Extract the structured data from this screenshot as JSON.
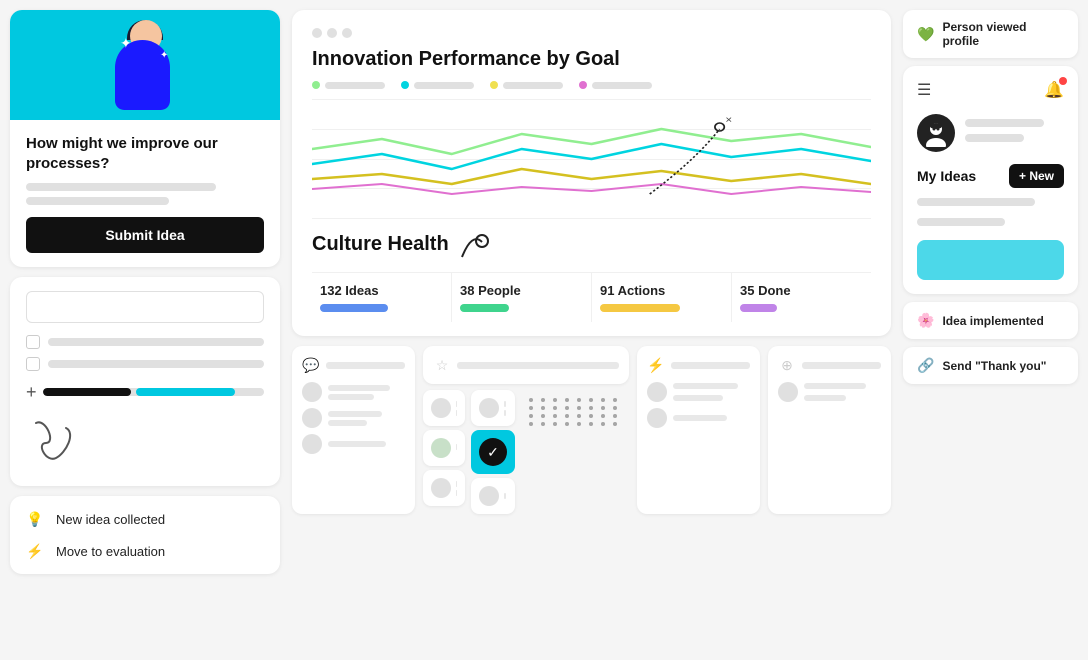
{
  "left": {
    "card_idea": {
      "title": "How might we improve our processes?",
      "submit_label": "Submit Idea"
    },
    "notifications": {
      "new_idea": "New idea collected",
      "move_eval": "Move to evaluation"
    }
  },
  "center": {
    "chart": {
      "window_dots": [
        "red",
        "yellow",
        "green"
      ],
      "title": "Innovation Performance by Goal",
      "legend": [
        {
          "color": "#90ee90",
          "label": ""
        },
        {
          "color": "#00d4e0",
          "label": ""
        },
        {
          "color": "#f0e050",
          "label": ""
        },
        {
          "color": "#e070d0",
          "label": ""
        }
      ],
      "culture_health": "Culture Health",
      "stats": [
        {
          "label": "132 Ideas",
          "bar_color": "#5b8def",
          "width": "55%"
        },
        {
          "label": "38 People",
          "bar_color": "#3fd48d",
          "width": "40%"
        },
        {
          "label": "91 Actions",
          "bar_color": "#f5c842",
          "width": "65%"
        },
        {
          "label": "35 Done",
          "bar_color": "#c084e8",
          "width": "30%"
        }
      ]
    }
  },
  "right": {
    "person_viewed": "Person viewed profile",
    "my_ideas": "My Ideas",
    "new_btn": "+ New",
    "idea_implemented": "Idea implemented",
    "send_thankyou": "Send \"Thank you\""
  }
}
